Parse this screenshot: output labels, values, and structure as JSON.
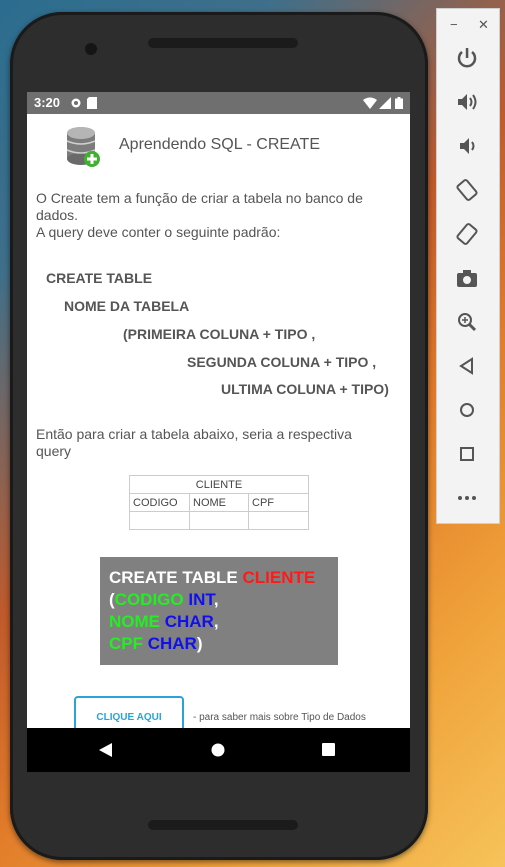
{
  "status_bar": {
    "time": "3:20"
  },
  "app": {
    "title": "Aprendendo SQL - CREATE"
  },
  "intro": {
    "line1": "O Create tem a função de criar a tabela no banco de",
    "line2": "dados.",
    "line3": "A query deve conter o seguinte padrão:"
  },
  "pattern": {
    "l1": "CREATE TABLE",
    "l2": "NOME DA TABELA",
    "l3": "(PRIMEIRA COLUNA + TIPO ,",
    "l4": "SEGUNDA COLUNA + TIPO ,",
    "l5": "ULTIMA COLUNA + TIPO)"
  },
  "example_intro": {
    "line1": "Então para criar a tabela abaixo, seria a respectiva",
    "line2": "query"
  },
  "table": {
    "name": "CLIENTE",
    "columns": [
      "CODIGO",
      "NOME",
      "CPF"
    ]
  },
  "sql": {
    "kw_create": "CREATE TABLE ",
    "table_name": "CLIENTE",
    "open_paren": "(",
    "col1": "CODIGO",
    "type1": " INT",
    "comma": ",",
    "col2": "NOME",
    "type2": " CHAR",
    "col3": "CPF",
    "type3": " CHAR",
    "close_paren": ")"
  },
  "button": {
    "label": "CLIQUE AQUI",
    "note": "- para saber mais sobre Tipo de Dados"
  },
  "colors": {
    "keyword": "#ffffff",
    "table_name": "#ff1a1a",
    "column": "#22ee22",
    "type": "#1010ee",
    "accent": "#29a3d9"
  }
}
